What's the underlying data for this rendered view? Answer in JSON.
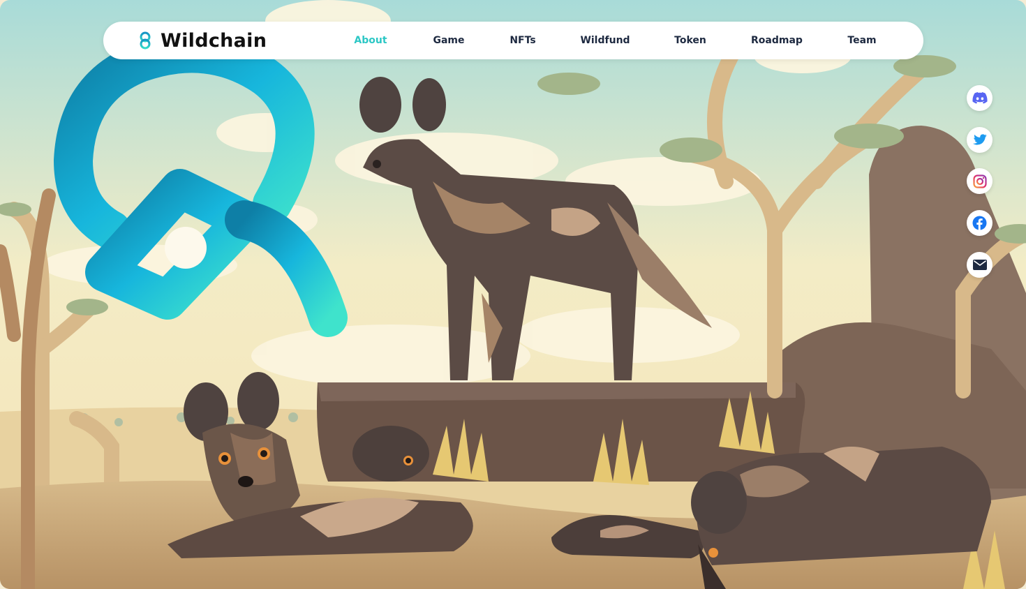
{
  "brand": {
    "name": "Wildchain",
    "logo_icon": "wildchain-chain-icon"
  },
  "nav": {
    "items": [
      {
        "label": "About",
        "active": true
      },
      {
        "label": "Game",
        "active": false
      },
      {
        "label": "NFTs",
        "active": false
      },
      {
        "label": "Wildfund",
        "active": false
      },
      {
        "label": "Token",
        "active": false
      },
      {
        "label": "Roadmap",
        "active": false
      },
      {
        "label": "Team",
        "active": false
      }
    ],
    "active_color": "#2cc7c5",
    "text_color": "#1d2940"
  },
  "social": [
    {
      "icon": "discord-icon",
      "color": "#5865f2"
    },
    {
      "icon": "twitter-icon",
      "color": "#1d9bf0"
    },
    {
      "icon": "instagram-icon",
      "color": "#e1306c"
    },
    {
      "icon": "facebook-icon",
      "color": "#1877f2"
    },
    {
      "icon": "email-icon",
      "color": "#1d2940"
    }
  ],
  "hero": {
    "description": "Illustrated savanna scene with African wild dogs",
    "logo_gradient": [
      "#0e7fa6",
      "#17b6dc",
      "#3fe3cc"
    ]
  }
}
